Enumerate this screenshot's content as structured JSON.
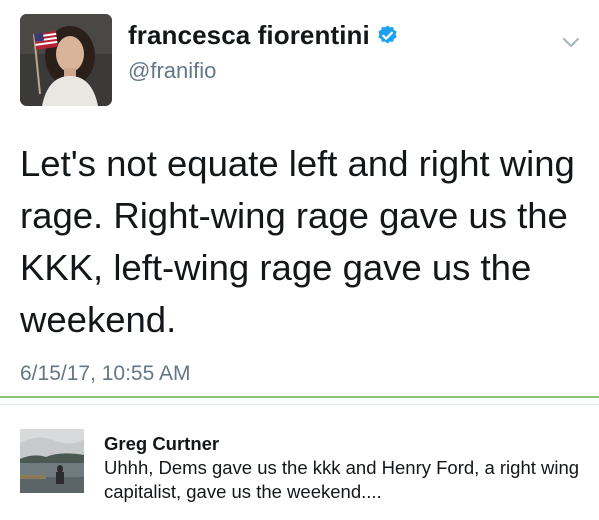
{
  "tweet": {
    "author_name": "francesca fiorentini",
    "handle": "@franifio",
    "verified": true,
    "text": "Let's not equate left and right wing rage. Right-wing rage gave us the KKK, left-wing rage gave us the weekend.",
    "timestamp": "6/15/17, 10:55 AM",
    "avatar_icon": "profile-photo-woman-with-flag",
    "menu_icon": "chevron-down-icon"
  },
  "reply": {
    "author_name": "Greg Curtner",
    "text": "Uhhh, Dems gave us the kkk and Henry Ford, a right wing capitalist, gave us the weekend....",
    "avatar_icon": "profile-photo-lake-landscape"
  },
  "colors": {
    "verified_badge": "#1da1f2",
    "secondary_text": "#657786",
    "divider_accent": "#8bc47a"
  }
}
